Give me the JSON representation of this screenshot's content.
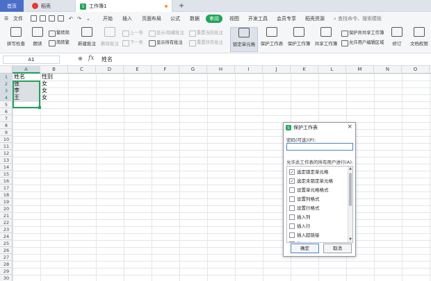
{
  "tabs": {
    "home": "首页",
    "daoke": "稻壳",
    "document": "工作簿1",
    "new_tab": "+"
  },
  "menu": {
    "file": "文件",
    "items": [
      "开始",
      "插入",
      "页面布局",
      "公式",
      "数据",
      "审阅",
      "视图",
      "开发工具",
      "会员专享",
      "稻壳资源"
    ],
    "active": "审阅",
    "search": "查找命令、搜索模板"
  },
  "ribbon": {
    "spell_check": "拼写检查",
    "read_aloud": "朗读",
    "to_simplified": "繁转简",
    "to_traditional": "简转繁",
    "new_comment": "新建批注",
    "delete_comment": "删除批注",
    "prev": "上一条",
    "next": "下一条",
    "show_hide_comment": "显示/隐藏批注",
    "show_all_comments": "显示所有批注",
    "reset_current_comment": "重置当前批注",
    "reset_all_comments": "重置所有批注",
    "lock_cells": "锁定单元格",
    "protect_sheet": "保护工作表",
    "protect_workbook": "保护工作簿",
    "share_workbook": "共享工作簿",
    "protect_and_share": "保护并共享工作簿",
    "allow_edit_ranges": "允许用户编辑区域",
    "track_changes": "修订",
    "doc_permissions": "文档权限"
  },
  "formula_bar": {
    "name_box": "A1",
    "fx": "fx",
    "content": "姓名"
  },
  "columns": [
    "A",
    "B",
    "C",
    "D",
    "E",
    "F",
    "G",
    "H",
    "I",
    "J",
    "K",
    "L",
    "M",
    "N",
    "O"
  ],
  "rows": [
    "1",
    "2",
    "3",
    "4",
    "5",
    "6",
    "7",
    "8",
    "9",
    "10",
    "11",
    "12",
    "13",
    "14",
    "15",
    "16",
    "17",
    "18",
    "19",
    "20",
    "21",
    "22",
    "23",
    "24",
    "25",
    "26",
    "27",
    "28",
    "29",
    "30"
  ],
  "cells": [
    {
      "ref": "A1",
      "value": "姓名"
    },
    {
      "ref": "B1",
      "value": "性别"
    },
    {
      "ref": "A2",
      "value": "张"
    },
    {
      "ref": "B2",
      "value": "女"
    },
    {
      "ref": "A3",
      "value": "李"
    },
    {
      "ref": "B3",
      "value": "女"
    },
    {
      "ref": "A4",
      "value": "王"
    },
    {
      "ref": "B4",
      "value": "女"
    }
  ],
  "dialog": {
    "title": "保护工作表",
    "password_label": "密码(可选)(P):",
    "password_value": "",
    "allow_label": "允许此工作表的所有用户进行(A):",
    "options": [
      {
        "label": "选定锁定单元格",
        "checked": true
      },
      {
        "label": "选定未锁定单元格",
        "checked": true
      },
      {
        "label": "设置单元格格式",
        "checked": false
      },
      {
        "label": "设置列格式",
        "checked": false
      },
      {
        "label": "设置行格式",
        "checked": false
      },
      {
        "label": "插入列",
        "checked": false
      },
      {
        "label": "插入行",
        "checked": false
      },
      {
        "label": "插入超链接",
        "checked": false
      },
      {
        "label": "删除列",
        "checked": false
      }
    ],
    "ok": "确定",
    "cancel": "取消",
    "close": "×"
  },
  "colors": {
    "accent_green": "#1fa45a",
    "home_tab_blue": "#4b6ec8"
  }
}
